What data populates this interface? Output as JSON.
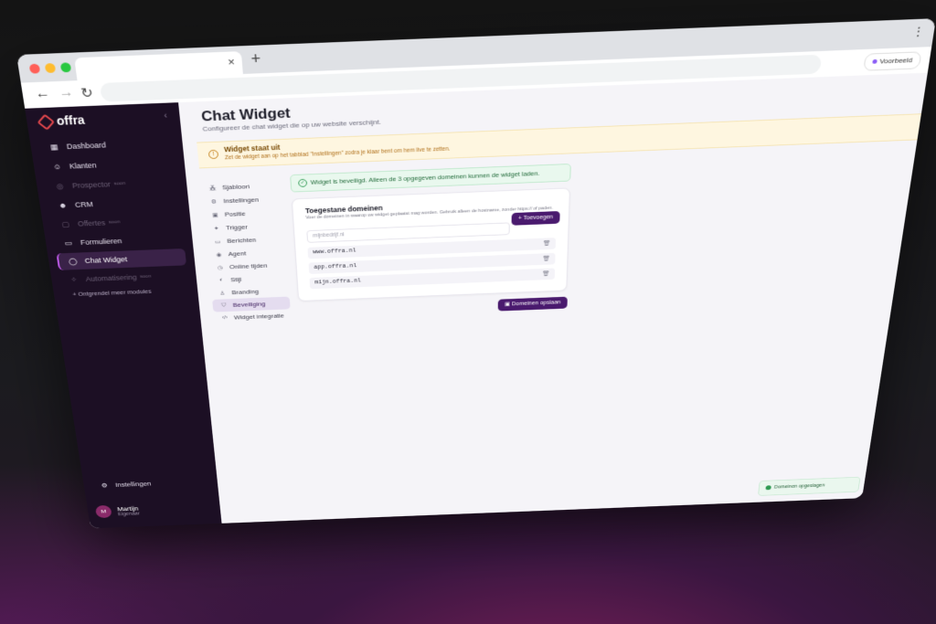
{
  "browser": {
    "new_tab": "+",
    "close_tab": "×",
    "preview_label": "Voorbeeld"
  },
  "brand": {
    "name": "offra"
  },
  "sidebar": {
    "items": [
      {
        "label": "Dashboard",
        "icon": "grid-icon"
      },
      {
        "label": "Klanten",
        "icon": "users-icon"
      },
      {
        "label": "Prospector",
        "icon": "target-icon",
        "badge": "soon"
      },
      {
        "label": "CRM",
        "icon": "people-icon"
      },
      {
        "label": "Offertes",
        "icon": "document-icon",
        "badge": "soon"
      },
      {
        "label": "Formulieren",
        "icon": "form-icon"
      },
      {
        "label": "Chat Widget",
        "icon": "chat-icon"
      },
      {
        "label": "Automatisering",
        "icon": "automation-icon",
        "badge": "soon"
      }
    ],
    "unlock_label": "Ontgrendel meer modules",
    "settings_label": "Instellingen",
    "user": {
      "initial": "M",
      "name": "Martijn",
      "role": "Eigenaar"
    }
  },
  "page": {
    "title": "Chat Widget",
    "subtitle": "Configureer de chat widget die op uw website verschijnt."
  },
  "warning": {
    "title": "Widget staat uit",
    "text": "Zet de widget aan op het tabblad \"Instellingen\" zodra je klaar bent om hem live te zetten."
  },
  "subnav": [
    {
      "label": "Sjabloon"
    },
    {
      "label": "Instellingen"
    },
    {
      "label": "Positie"
    },
    {
      "label": "Trigger"
    },
    {
      "label": "Berichten"
    },
    {
      "label": "Agent"
    },
    {
      "label": "Online tijden"
    },
    {
      "label": "Stijl"
    },
    {
      "label": "Branding"
    },
    {
      "label": "Beveiliging"
    },
    {
      "label": "Widget integratie"
    }
  ],
  "success": {
    "text": "Widget is beveiligd. Alleen de 3 opgegeven domeinen kunnen de widget laden."
  },
  "domains": {
    "title": "Toegestane domeinen",
    "description": "Voer de domeinen in waarop uw widget geplaatst mag worden. Gebruik alleen de hostname, zonder https:// of paden.",
    "add_label": "+ Toevoegen",
    "placeholder": "mijnbedrijf.nl",
    "list": [
      "www.offra.nl",
      "app.offra.nl",
      "mijn.offra.nl"
    ],
    "save_label": "Domeinen opslaan"
  },
  "toast": {
    "text": "Domeinen opgeslagen"
  },
  "colors": {
    "accent": "#4a1a6e",
    "sidebar": "#1c0f24"
  }
}
